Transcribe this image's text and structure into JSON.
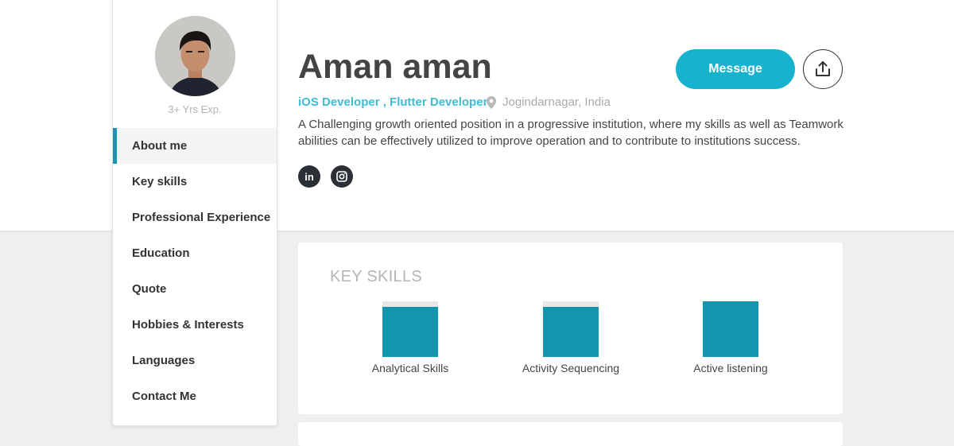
{
  "profile": {
    "name": "Aman aman",
    "roles": "iOS Developer , Flutter Developer",
    "location": "Jogindarnagar, India",
    "experience": "3+ Yrs Exp.",
    "bio": "A Challenging growth oriented position in a progressive institution, where my skills as well as Teamwork abilities can be effectively utilized to improve operation and to contribute to institutions success."
  },
  "actions": {
    "message_label": "Message",
    "share_icon": "share-upload-icon"
  },
  "social": [
    {
      "name": "linkedin",
      "label": "in",
      "icon": "linkedin-icon"
    },
    {
      "name": "instagram",
      "icon": "instagram-icon"
    }
  ],
  "nav": {
    "items": [
      {
        "label": "About me",
        "active": true
      },
      {
        "label": "Key skills",
        "active": false
      },
      {
        "label": "Professional Experience",
        "active": false
      },
      {
        "label": "Education",
        "active": false
      },
      {
        "label": "Quote",
        "active": false
      },
      {
        "label": "Hobbies & Interests",
        "active": false
      },
      {
        "label": "Languages",
        "active": false
      },
      {
        "label": "Contact Me",
        "active": false
      }
    ]
  },
  "key_skills": {
    "title": "KEY SKILLS",
    "items": [
      {
        "label": "Analytical Skills",
        "level": 0.9
      },
      {
        "label": "Activity Sequencing",
        "level": 0.9
      },
      {
        "label": "Active listening",
        "level": 1.0
      }
    ]
  },
  "colors": {
    "accent": "#16b2ce",
    "skill_fill": "#1196ae",
    "nav_active_border": "#1596ae",
    "role_text": "#3fbcd4"
  }
}
